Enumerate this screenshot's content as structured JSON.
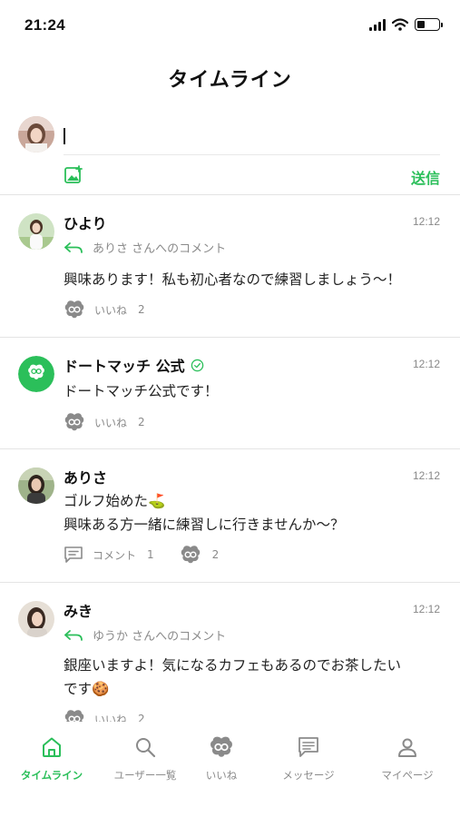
{
  "status_bar": {
    "time": "21:24"
  },
  "header": {
    "title": "タイムライン"
  },
  "composer": {
    "value": "",
    "send_label": "送信"
  },
  "posts": [
    {
      "name": "ひより",
      "time": "12:12",
      "reply_to": "ありさ さんへのコメント",
      "body": "興味あります！私も初心者なので練習しましょう〜！",
      "like_label": "いいね",
      "like_count": "2"
    },
    {
      "name": "ドートマッチ 公式",
      "verified": true,
      "time": "12:12",
      "body": "ドートマッチ公式です！",
      "like_label": "いいね",
      "like_count": "2"
    },
    {
      "name": "ありさ",
      "time": "12:12",
      "body_line1": "ゴルフ始めた⛳",
      "body_line2": "興味ある方一緒に練習しに行きませんか〜？",
      "comment_label": "コメント",
      "comment_count": "1",
      "like_count": "2"
    },
    {
      "name": "みき",
      "time": "12:12",
      "reply_to": "ゆうか さんへのコメント",
      "body_line1": "銀座いますよ！気になるカフェもあるのでお茶したい",
      "body_line2": "です🍪",
      "like_label": "いいね",
      "like_count": "2"
    }
  ],
  "tabs": [
    {
      "label": "タイムライン",
      "icon": "home-icon",
      "active": true
    },
    {
      "label": "ユーザー一覧",
      "icon": "search-icon"
    },
    {
      "label": "いいね",
      "icon": "like-icon"
    },
    {
      "label": "メッセージ",
      "icon": "message-icon"
    },
    {
      "label": "マイページ",
      "icon": "person-icon"
    }
  ],
  "colors": {
    "accent": "#2bbf5a",
    "muted": "#8a8a8a",
    "divider": "#e4e4e4"
  }
}
